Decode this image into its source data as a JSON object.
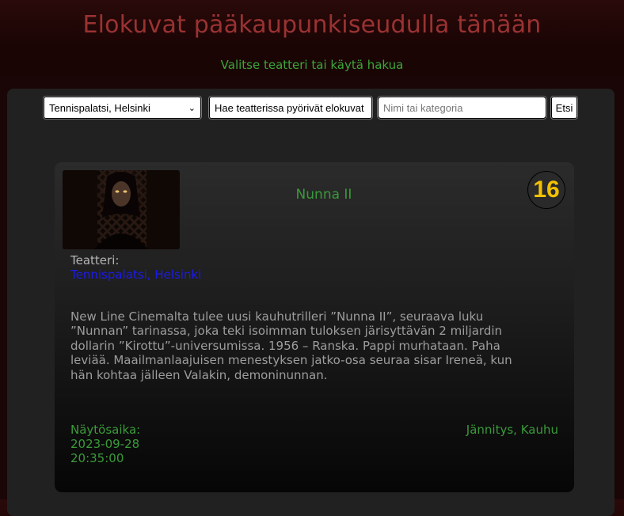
{
  "header": {
    "title": "Elokuvat pääkaupunkiseudulla tänään",
    "subtitle": "Valitse teatteri tai käytä hakua"
  },
  "controls": {
    "theater_select_value": "Tennispalatsi, Helsinki",
    "theater_movies_button": "Hae teatterissa pyörivät elokuvat",
    "search_placeholder": "Nimi tai kategoria",
    "search_button": "Etsi"
  },
  "movie": {
    "title": "Nunna II",
    "age_rating": "16",
    "theater_label": "Teatteri:",
    "theater_name": "Tennispalatsi, Helsinki",
    "description": "New Line Cinemalta tulee uusi kauhutrilleri ”Nunna II”, seuraava luku ”Nunnan” tarinassa, joka teki isoimman tuloksen järisyttävän 2 miljardin dollarin ”Kirottu”-universumissa. 1956 – Ranska. Pappi murhataan. Paha leviää. Maailmanlaajuisen menestyksen jatko-osa seuraa sisar Ireneä, kun hän kohtaa jälleen Valakin, demoninunnan.",
    "showtime_label": "Näytösaika:",
    "show_date": "2023-09-28",
    "show_time": "20:35:00",
    "genres": "Jännitys, Kauhu",
    "rating_color": "#f2c200",
    "accent_color": "#3a9a3a"
  }
}
